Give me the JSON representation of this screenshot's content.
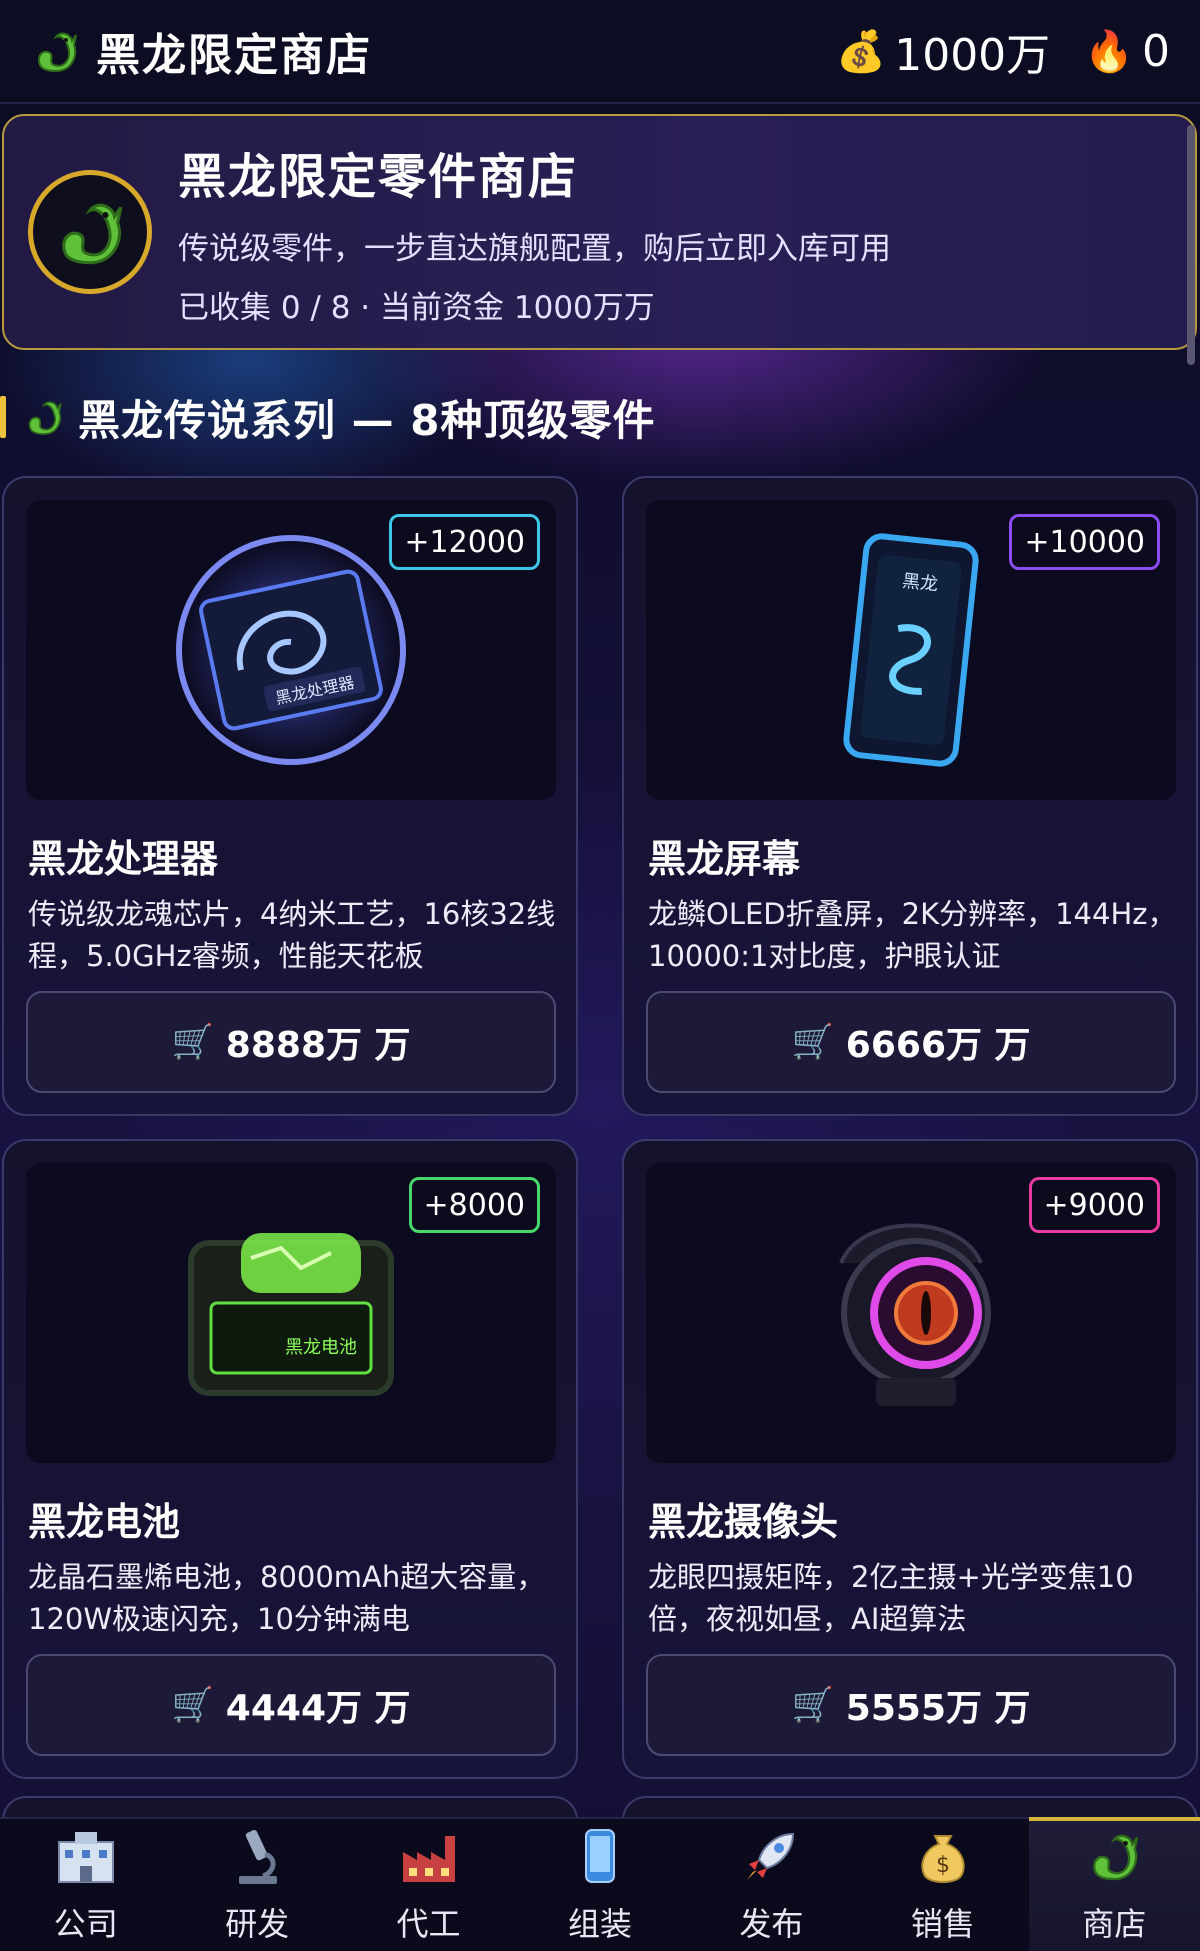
{
  "header": {
    "title": "黑龙限定商店",
    "money": "1000万",
    "fire": "0",
    "money_icon": "money-bag-icon",
    "fire_icon": "fire-icon"
  },
  "banner": {
    "title": "黑龙限定零件商店",
    "subtitle": "传说级零件，一步直达旗舰配置，购后立即入库可用",
    "stats": "已收集 0 / 8  ·  当前资金 1000万万"
  },
  "section": {
    "title": "黑龙传说系列 — 8种顶级零件"
  },
  "products": [
    {
      "name": "黑龙处理器",
      "power": "+12000",
      "power_color": "#3ec6e8",
      "desc": "传说级龙魂芯片，4纳米工艺，16核32线程，5.0GHz睿频，性能天花板",
      "price": "8888万 万",
      "image_label": "黑龙处理器"
    },
    {
      "name": "黑龙屏幕",
      "power": "+10000",
      "power_color": "#8a4cf0",
      "desc": "龙鳞OLED折叠屏，2K分辨率，144Hz，10000:1对比度，护眼认证",
      "price": "6666万 万",
      "image_label": "黑龙"
    },
    {
      "name": "黑龙电池",
      "power": "+8000",
      "power_color": "#46d86a",
      "desc": "龙晶石墨烯电池，8000mAh超大容量，120W极速闪充，10分钟满电",
      "price": "4444万 万",
      "image_label": "黑龙电池"
    },
    {
      "name": "黑龙摄像头",
      "power": "+9000",
      "power_color": "#e83aa0",
      "desc": "龙眼四摄矩阵，2亿主摄+光学变焦10倍，夜视如昼，AI超算法",
      "price": "5555万 万",
      "image_label": ""
    }
  ],
  "nav": [
    {
      "label": "公司",
      "icon": "company-building-icon"
    },
    {
      "label": "研发",
      "icon": "microscope-icon"
    },
    {
      "label": "代工",
      "icon": "factory-icon"
    },
    {
      "label": "组装",
      "icon": "assembly-icon"
    },
    {
      "label": "发布",
      "icon": "rocket-icon"
    },
    {
      "label": "销售",
      "icon": "money-bag-icon"
    },
    {
      "label": "商店",
      "icon": "dragon-icon",
      "active": true
    }
  ],
  "colors": {
    "accent_gold": "#d7b53a",
    "dragon_green": "#5fc03a"
  }
}
